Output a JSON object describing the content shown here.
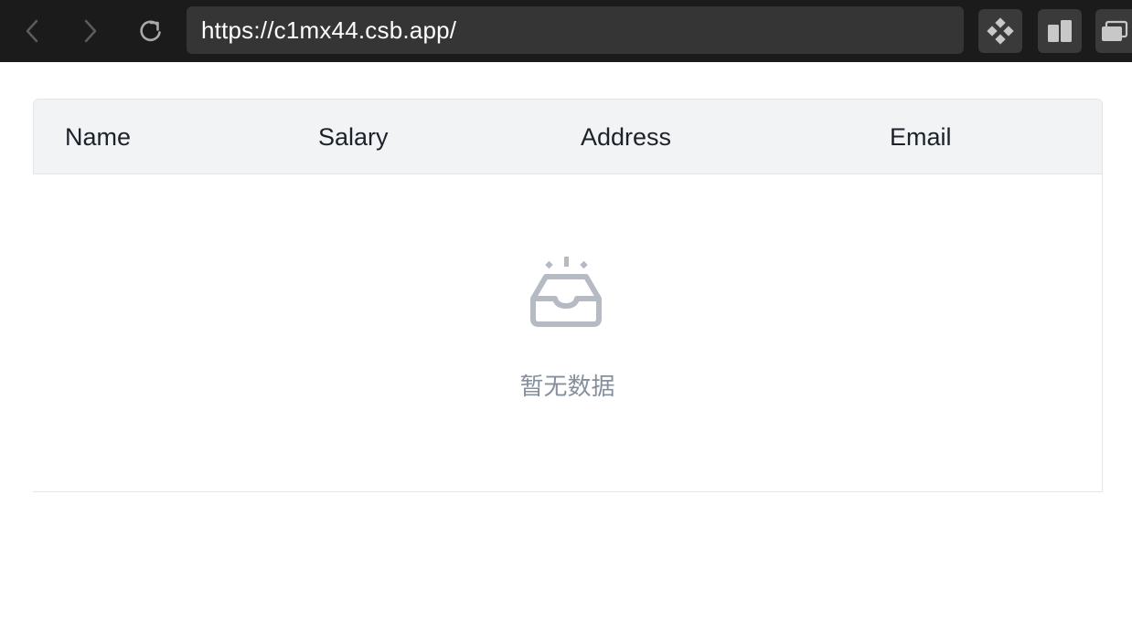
{
  "browser": {
    "url": "https://c1mx44.csb.app/",
    "icons": {
      "back": "chevron-left-icon",
      "forward": "chevron-right-icon",
      "reload": "reload-icon",
      "extension": "diamond-grid-icon",
      "split": "split-view-icon",
      "tabs": "tabs-icon"
    }
  },
  "table": {
    "columns": [
      "Name",
      "Salary",
      "Address",
      "Email"
    ],
    "rows": [],
    "empty_text": "暂无数据",
    "empty_icon": "empty-inbox-icon"
  },
  "colors": {
    "toolbar_bg": "#1b1b1b",
    "url_bg": "#353535",
    "header_bg": "#f2f3f5",
    "border": "#e3e5e8",
    "empty_text": "#86909c"
  }
}
